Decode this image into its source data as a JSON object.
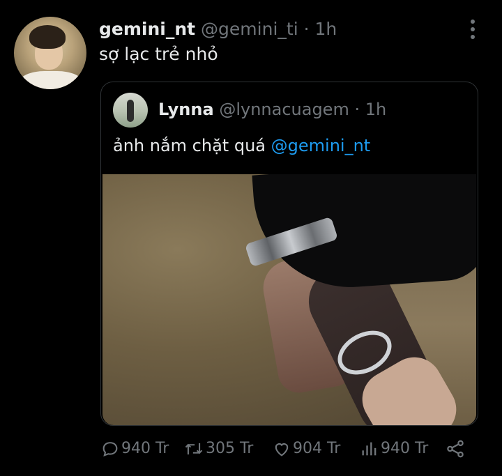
{
  "tweet": {
    "display_name": "gemini_nt",
    "handle": "@gemini_ti",
    "separator": "·",
    "time": "1h",
    "text": "sợ lạc trẻ nhỏ"
  },
  "quoted_tweet": {
    "display_name": "Lynna",
    "handle": "@lynnacuagem",
    "separator": "·",
    "time": "1h",
    "text": "ảnh nắm chặt quá",
    "mention": "@gemini_nt"
  },
  "actions": {
    "replies": "940 Tr",
    "retweets": "305 Tr",
    "likes": "904 Tr",
    "views": "940 Tr"
  },
  "colors": {
    "background": "#000000",
    "text": "#e7e9ea",
    "muted": "#71767b",
    "accent": "#1d9bf0",
    "border": "#2f3336"
  },
  "icons": [
    "more-vertical-icon",
    "reply-icon",
    "retweet-icon",
    "like-icon",
    "views-icon",
    "share-icon"
  ]
}
